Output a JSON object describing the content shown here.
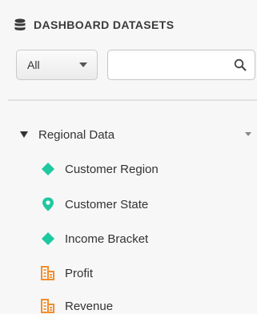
{
  "header": {
    "title": "DASHBOARD DATASETS",
    "icon": "database-icon"
  },
  "filters": {
    "scope_value": "All",
    "search_placeholder": "",
    "search_value": ""
  },
  "tree": {
    "group_label": "Regional Data",
    "items": [
      {
        "label": "Customer Region",
        "icon": "diamond-icon",
        "color": "#1ec8a0"
      },
      {
        "label": "Customer State",
        "icon": "map-pin-icon",
        "color": "#1ec8a0"
      },
      {
        "label": "Income Bracket",
        "icon": "diamond-icon",
        "color": "#1ec8a0"
      },
      {
        "label": "Profit",
        "icon": "measure-icon",
        "color": "#f28e2b"
      },
      {
        "label": "Revenue",
        "icon": "measure-icon",
        "color": "#f28e2b"
      }
    ]
  },
  "colors": {
    "dimension": "#1ec8a0",
    "measure": "#f28e2b",
    "background": "#f7f7f7"
  }
}
